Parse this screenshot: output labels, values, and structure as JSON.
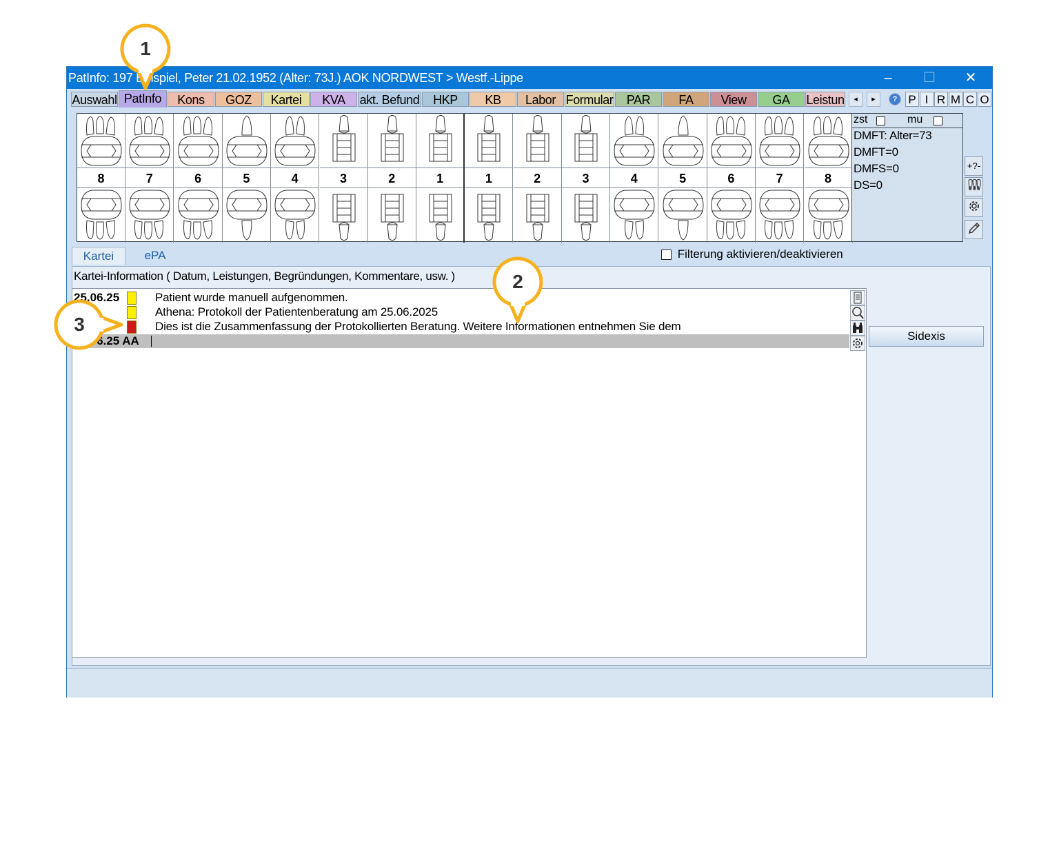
{
  "window": {
    "title": "PatInfo: 197 Beispiel, Peter  21.02.1952 (Alter: 73J.)  AOK NORDWEST > Westf.-Lippe",
    "minimize": "–",
    "maximize": "☐",
    "close": "✕"
  },
  "tabs": [
    {
      "label": "Auswahl",
      "color": "#c9d6e4"
    },
    {
      "label": "PatInfo",
      "color": "#b7a8e8"
    },
    {
      "label": "Kons",
      "color": "#eebcab"
    },
    {
      "label": "GOZ",
      "color": "#eebf9d"
    },
    {
      "label": "Kartei",
      "color": "#e6e0a0"
    },
    {
      "label": "KVA",
      "color": "#cdb1e8"
    },
    {
      "label": "akt. Befund",
      "color": "#b5cde4"
    },
    {
      "label": "HKP",
      "color": "#a9c7d8"
    },
    {
      "label": "KB",
      "color": "#efc9a8"
    },
    {
      "label": "Labor",
      "color": "#e2c0a1"
    },
    {
      "label": "Formular",
      "color": "#dcdcae"
    },
    {
      "label": "PAR",
      "color": "#aac79c"
    },
    {
      "label": "FA",
      "color": "#d1a57b"
    },
    {
      "label": "View",
      "color": "#cc8f95"
    },
    {
      "label": "GA",
      "color": "#97ce8e"
    },
    {
      "label": "Leistun",
      "color": "#e9c2c5"
    }
  ],
  "nav": {
    "prev": "◂",
    "next": "▸",
    "help": "?"
  },
  "letter_buttons": [
    "P",
    "I",
    "R",
    "M",
    "C",
    "O"
  ],
  "teeth": {
    "numbers": [
      "8",
      "7",
      "6",
      "5",
      "4",
      "3",
      "2",
      "1",
      "1",
      "2",
      "3",
      "4",
      "5",
      "6",
      "7",
      "8"
    ],
    "types": [
      "molar",
      "molar",
      "molar",
      "premolar",
      "bipremolar",
      "front",
      "front",
      "front",
      "front",
      "front",
      "front",
      "bipremolar",
      "premolar",
      "molar",
      "molar",
      "molar"
    ]
  },
  "dmft": {
    "zst": "zst",
    "mu": "mu",
    "lines": [
      "DMFT: Alter=73",
      "DMFT=0",
      "DMFS=0",
      "DS=0"
    ]
  },
  "side_tools": [
    "+?-",
    "teeth-icon",
    "gear-icon",
    "pencil-icon"
  ],
  "subtabs": [
    "Kartei",
    "ePA"
  ],
  "filter_label": "Filterung aktivieren/deaktivieren",
  "panel_caption": "Kartei-Information ( Datum, Leistungen, Begründungen, Kommentare, usw. )",
  "entries": [
    {
      "date": "25.06.25",
      "text": "Patient wurde manuell aufgenommen.",
      "flag": "#ffef00"
    },
    {
      "date": "",
      "text": "Athena: Protokoll der Patientenberatung am 25.06.2025",
      "flag": "#ffef00"
    },
    {
      "date": "",
      "text": "Dies ist die Zusammenfassung der Protokollierten Beratung. Weitere Informationen entnehmen Sie dem",
      "flag": "#cc1a1a"
    }
  ],
  "input_row": {
    "date": "25.06.25 AA"
  },
  "sidexis_label": "Sidexis",
  "callouts": [
    "1",
    "2",
    "3"
  ],
  "colors": {
    "titlebar": "#0a78d7",
    "callout": "#f5b21e"
  }
}
